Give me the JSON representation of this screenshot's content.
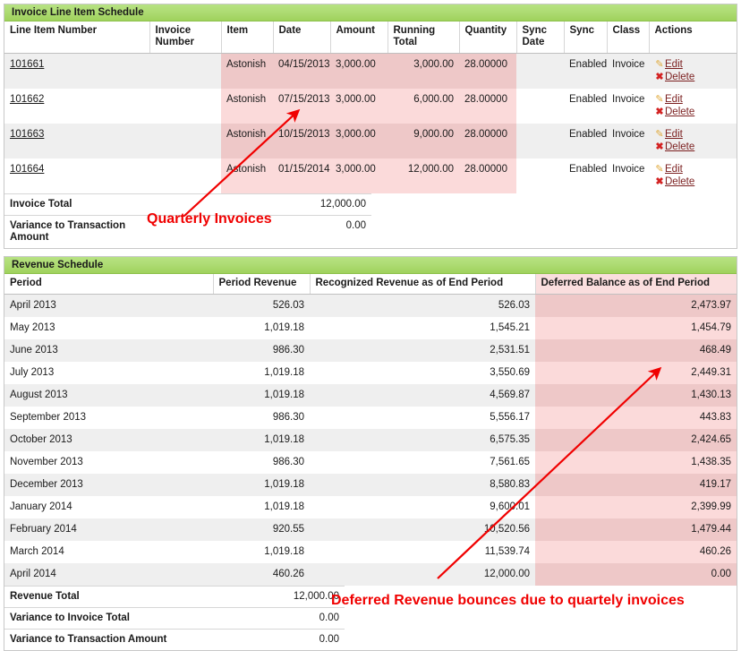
{
  "invoice_panel": {
    "title": "Invoice Line Item Schedule",
    "columns": [
      "Line Item Number",
      "Invoice Number",
      "Item",
      "Date",
      "Amount",
      "Running Total",
      "Quantity",
      "Sync Date",
      "Sync",
      "Class",
      "Actions"
    ],
    "rows": [
      {
        "line_item_number": "101661",
        "invoice_number": "",
        "item": "Astonish",
        "date": "04/15/2013",
        "amount": "3,000.00",
        "running_total": "3,000.00",
        "quantity": "28.00000",
        "sync_date": "",
        "sync": "Enabled",
        "class": "Invoice",
        "edit_label": "Edit",
        "delete_label": "Delete"
      },
      {
        "line_item_number": "101662",
        "invoice_number": "",
        "item": "Astonish",
        "date": "07/15/2013",
        "amount": "3,000.00",
        "running_total": "6,000.00",
        "quantity": "28.00000",
        "sync_date": "",
        "sync": "Enabled",
        "class": "Invoice",
        "edit_label": "Edit",
        "delete_label": "Delete"
      },
      {
        "line_item_number": "101663",
        "invoice_number": "",
        "item": "Astonish",
        "date": "10/15/2013",
        "amount": "3,000.00",
        "running_total": "9,000.00",
        "quantity": "28.00000",
        "sync_date": "",
        "sync": "Enabled",
        "class": "Invoice",
        "edit_label": "Edit",
        "delete_label": "Delete"
      },
      {
        "line_item_number": "101664",
        "invoice_number": "",
        "item": "Astonish",
        "date": "01/15/2014",
        "amount": "3,000.00",
        "running_total": "12,000.00",
        "quantity": "28.00000",
        "sync_date": "",
        "sync": "Enabled",
        "class": "Invoice",
        "edit_label": "Edit",
        "delete_label": "Delete"
      }
    ],
    "footer": [
      {
        "label": "Invoice Total",
        "value": "12,000.00"
      },
      {
        "label": "Variance to Transaction Amount",
        "value": "0.00"
      }
    ]
  },
  "revenue_panel": {
    "title": "Revenue Schedule",
    "columns": [
      "Period",
      "Period Revenue",
      "Recognized Revenue as of End Period",
      "Deferred Balance as of End Period"
    ],
    "rows": [
      {
        "period": "April 2013",
        "period_revenue": "526.03",
        "recognized": "526.03",
        "deferred": "2,473.97"
      },
      {
        "period": "May 2013",
        "period_revenue": "1,019.18",
        "recognized": "1,545.21",
        "deferred": "1,454.79"
      },
      {
        "period": "June 2013",
        "period_revenue": "986.30",
        "recognized": "2,531.51",
        "deferred": "468.49"
      },
      {
        "period": "July 2013",
        "period_revenue": "1,019.18",
        "recognized": "3,550.69",
        "deferred": "2,449.31"
      },
      {
        "period": "August 2013",
        "period_revenue": "1,019.18",
        "recognized": "4,569.87",
        "deferred": "1,430.13"
      },
      {
        "period": "September 2013",
        "period_revenue": "986.30",
        "recognized": "5,556.17",
        "deferred": "443.83"
      },
      {
        "period": "October 2013",
        "period_revenue": "1,019.18",
        "recognized": "6,575.35",
        "deferred": "2,424.65"
      },
      {
        "period": "November 2013",
        "period_revenue": "986.30",
        "recognized": "7,561.65",
        "deferred": "1,438.35"
      },
      {
        "period": "December 2013",
        "period_revenue": "1,019.18",
        "recognized": "8,580.83",
        "deferred": "419.17"
      },
      {
        "period": "January 2014",
        "period_revenue": "1,019.18",
        "recognized": "9,600.01",
        "deferred": "2,399.99"
      },
      {
        "period": "February 2014",
        "period_revenue": "920.55",
        "recognized": "10,520.56",
        "deferred": "1,479.44"
      },
      {
        "period": "March 2014",
        "period_revenue": "1,019.18",
        "recognized": "11,539.74",
        "deferred": "460.26"
      },
      {
        "period": "April 2014",
        "period_revenue": "460.26",
        "recognized": "12,000.00",
        "deferred": "0.00"
      }
    ],
    "footer": [
      {
        "label": "Revenue Total",
        "value": "12,000.00"
      },
      {
        "label": "Variance to Invoice Total",
        "value": "0.00"
      },
      {
        "label": "Variance to Transaction Amount",
        "value": "0.00"
      }
    ]
  },
  "annotations": [
    {
      "id": "quarterly",
      "text": "Quarterly Invoices"
    },
    {
      "id": "deferred",
      "text": "Deferred Revenue bounces due to quartely invoices"
    }
  ],
  "colors": {
    "header_green_top": "#b7e283",
    "header_green_bottom": "#9fd25c",
    "highlight_pink_light": "#fbdada",
    "highlight_pink_dark": "#eec8c8",
    "annotation_red": "#f00000",
    "row_alt_gray": "#efefef"
  }
}
